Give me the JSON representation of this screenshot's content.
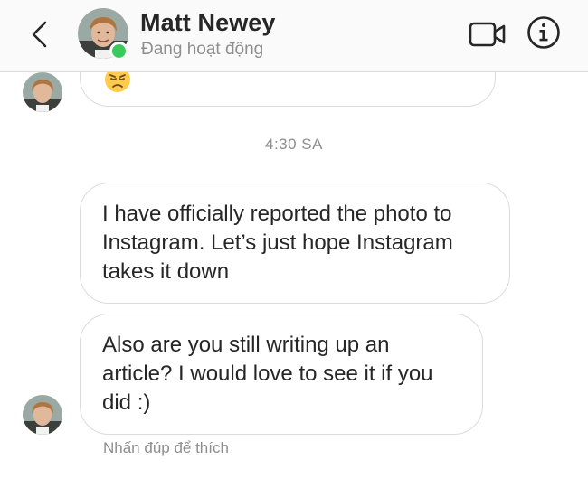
{
  "header": {
    "contact_name": "Matt Newey",
    "status": "Đang hoạt động",
    "icons": {
      "back": "chevron-left-icon",
      "video": "video-call-icon",
      "info": "info-icon"
    },
    "online_indicator_color": "#3ac95b"
  },
  "thread": {
    "previous_message_emoji": "😞",
    "timestamp": "4:30 SA",
    "messages": [
      {
        "text": "I have officially reported the photo to Instagram. Let’s just hope Instagram takes it down"
      },
      {
        "text": "Also are you still writing up an article? I would love to see it if you did :)"
      }
    ],
    "hint": "Nhấn đúp để thích"
  },
  "colors": {
    "header_bg": "#fafafa",
    "bubble_border": "#dbdbdb",
    "secondary_text": "#8e8e8e",
    "primary_text": "#262626"
  }
}
